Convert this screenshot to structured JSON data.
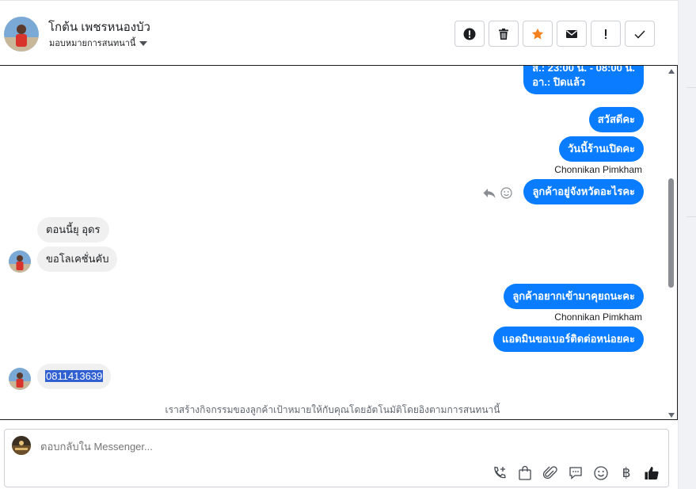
{
  "header": {
    "contact_name": "โกต้น เพชรหนองบัว",
    "assign_label": "มอบหมายการสนทนานี้",
    "actions": [
      {
        "name": "report-spam-button",
        "icon": "alert-circle-icon"
      },
      {
        "name": "delete-button",
        "icon": "trash-icon"
      },
      {
        "name": "star-button",
        "icon": "star-icon"
      },
      {
        "name": "mark-unread-button",
        "icon": "envelope-icon"
      },
      {
        "name": "follow-up-button",
        "icon": "exclamation-icon"
      },
      {
        "name": "mark-done-button",
        "icon": "check-icon"
      }
    ]
  },
  "conversation": {
    "hours_line1": "ส.: 23:00 น. - 08:00 น.",
    "hours_line2": "อา.: ปิดแล้ว",
    "msg_hello": "สวัสดีคะ",
    "msg_open_today": "วันนี้ร้านเปิดคะ",
    "sender_1": "Chonnikan Pimkham",
    "msg_province": "ลูกค้าอยู่จังหวัดอะไรคะ",
    "reply_location": "ตอนนี้ยุ อุดร",
    "reply_thanks": "ขอโลเคชั่นคับ",
    "msg_come_in": "ลูกค้าอยากเข้ามาคุยถนะคะ",
    "sender_2": "Chonnikan Pimkham",
    "msg_ask_phone": "แอดมินขอเบอร์ติดต่อหน่อยคะ",
    "reply_phone": "0811413639",
    "footnote": "เราสร้างกิจกรรมของลูกค้าเป้าหมายให้กับคุณโดยอัตโนมัติโดยอิงตามการสนทนานี้"
  },
  "composer": {
    "placeholder": "ตอบกลับใน Messenger...",
    "tools": [
      "phone-plus-icon",
      "shopping-bag-icon",
      "paperclip-icon",
      "saved-reply-icon",
      "emoji-icon",
      "baht-icon",
      "thumbs-up-icon"
    ],
    "baht_symbol": "฿"
  },
  "colors": {
    "outgoing_bubble": "#0a7cff",
    "incoming_bubble": "#f0f0f0",
    "star": "#f5821f"
  }
}
